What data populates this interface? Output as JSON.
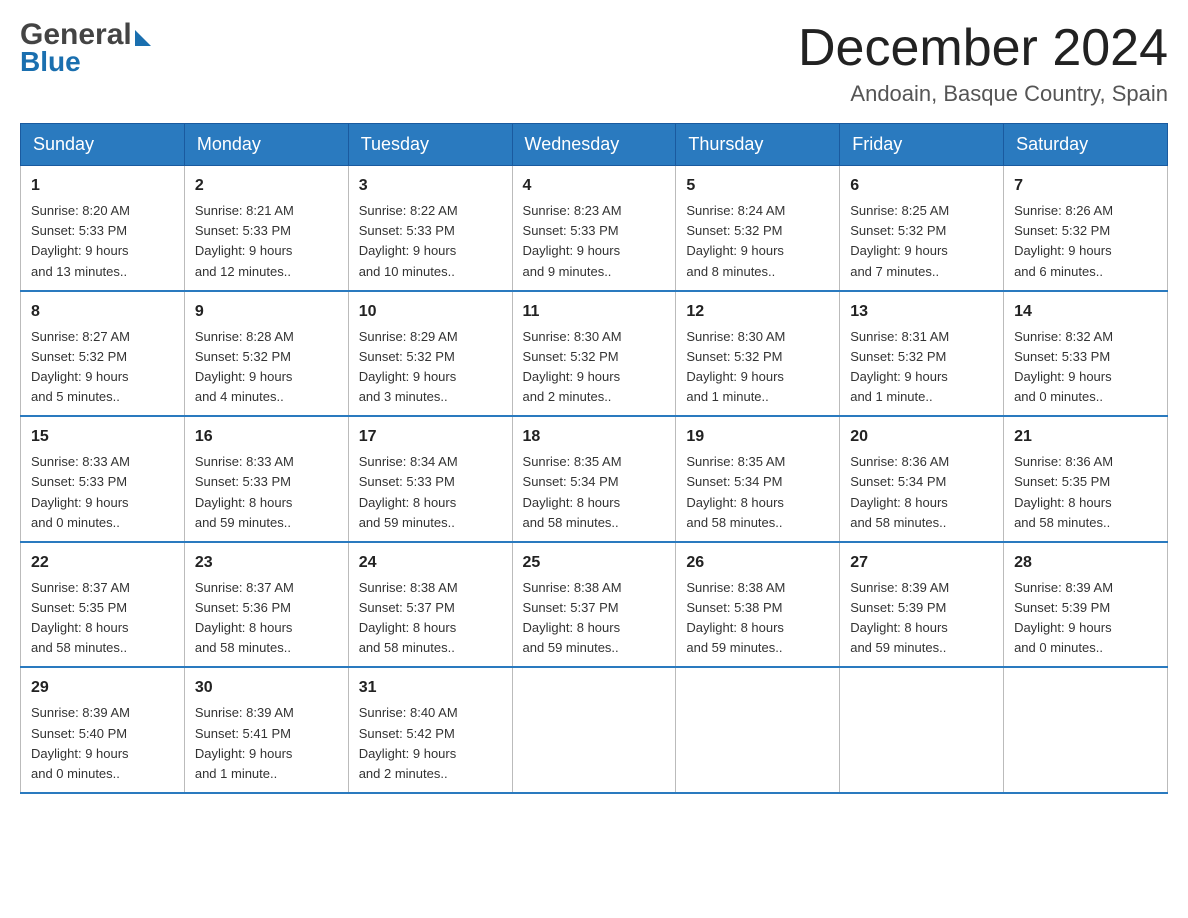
{
  "header": {
    "logo_general": "General",
    "logo_blue": "Blue",
    "month_title": "December 2024",
    "location": "Andoain, Basque Country, Spain"
  },
  "weekdays": [
    "Sunday",
    "Monday",
    "Tuesday",
    "Wednesday",
    "Thursday",
    "Friday",
    "Saturday"
  ],
  "weeks": [
    [
      {
        "day": "1",
        "sunrise": "8:20 AM",
        "sunset": "5:33 PM",
        "daylight": "9 hours and 13 minutes."
      },
      {
        "day": "2",
        "sunrise": "8:21 AM",
        "sunset": "5:33 PM",
        "daylight": "9 hours and 12 minutes."
      },
      {
        "day": "3",
        "sunrise": "8:22 AM",
        "sunset": "5:33 PM",
        "daylight": "9 hours and 10 minutes."
      },
      {
        "day": "4",
        "sunrise": "8:23 AM",
        "sunset": "5:33 PM",
        "daylight": "9 hours and 9 minutes."
      },
      {
        "day": "5",
        "sunrise": "8:24 AM",
        "sunset": "5:32 PM",
        "daylight": "9 hours and 8 minutes."
      },
      {
        "day": "6",
        "sunrise": "8:25 AM",
        "sunset": "5:32 PM",
        "daylight": "9 hours and 7 minutes."
      },
      {
        "day": "7",
        "sunrise": "8:26 AM",
        "sunset": "5:32 PM",
        "daylight": "9 hours and 6 minutes."
      }
    ],
    [
      {
        "day": "8",
        "sunrise": "8:27 AM",
        "sunset": "5:32 PM",
        "daylight": "9 hours and 5 minutes."
      },
      {
        "day": "9",
        "sunrise": "8:28 AM",
        "sunset": "5:32 PM",
        "daylight": "9 hours and 4 minutes."
      },
      {
        "day": "10",
        "sunrise": "8:29 AM",
        "sunset": "5:32 PM",
        "daylight": "9 hours and 3 minutes."
      },
      {
        "day": "11",
        "sunrise": "8:30 AM",
        "sunset": "5:32 PM",
        "daylight": "9 hours and 2 minutes."
      },
      {
        "day": "12",
        "sunrise": "8:30 AM",
        "sunset": "5:32 PM",
        "daylight": "9 hours and 1 minute."
      },
      {
        "day": "13",
        "sunrise": "8:31 AM",
        "sunset": "5:32 PM",
        "daylight": "9 hours and 1 minute."
      },
      {
        "day": "14",
        "sunrise": "8:32 AM",
        "sunset": "5:33 PM",
        "daylight": "9 hours and 0 minutes."
      }
    ],
    [
      {
        "day": "15",
        "sunrise": "8:33 AM",
        "sunset": "5:33 PM",
        "daylight": "9 hours and 0 minutes."
      },
      {
        "day": "16",
        "sunrise": "8:33 AM",
        "sunset": "5:33 PM",
        "daylight": "8 hours and 59 minutes."
      },
      {
        "day": "17",
        "sunrise": "8:34 AM",
        "sunset": "5:33 PM",
        "daylight": "8 hours and 59 minutes."
      },
      {
        "day": "18",
        "sunrise": "8:35 AM",
        "sunset": "5:34 PM",
        "daylight": "8 hours and 58 minutes."
      },
      {
        "day": "19",
        "sunrise": "8:35 AM",
        "sunset": "5:34 PM",
        "daylight": "8 hours and 58 minutes."
      },
      {
        "day": "20",
        "sunrise": "8:36 AM",
        "sunset": "5:34 PM",
        "daylight": "8 hours and 58 minutes."
      },
      {
        "day": "21",
        "sunrise": "8:36 AM",
        "sunset": "5:35 PM",
        "daylight": "8 hours and 58 minutes."
      }
    ],
    [
      {
        "day": "22",
        "sunrise": "8:37 AM",
        "sunset": "5:35 PM",
        "daylight": "8 hours and 58 minutes."
      },
      {
        "day": "23",
        "sunrise": "8:37 AM",
        "sunset": "5:36 PM",
        "daylight": "8 hours and 58 minutes."
      },
      {
        "day": "24",
        "sunrise": "8:38 AM",
        "sunset": "5:37 PM",
        "daylight": "8 hours and 58 minutes."
      },
      {
        "day": "25",
        "sunrise": "8:38 AM",
        "sunset": "5:37 PM",
        "daylight": "8 hours and 59 minutes."
      },
      {
        "day": "26",
        "sunrise": "8:38 AM",
        "sunset": "5:38 PM",
        "daylight": "8 hours and 59 minutes."
      },
      {
        "day": "27",
        "sunrise": "8:39 AM",
        "sunset": "5:39 PM",
        "daylight": "8 hours and 59 minutes."
      },
      {
        "day": "28",
        "sunrise": "8:39 AM",
        "sunset": "5:39 PM",
        "daylight": "9 hours and 0 minutes."
      }
    ],
    [
      {
        "day": "29",
        "sunrise": "8:39 AM",
        "sunset": "5:40 PM",
        "daylight": "9 hours and 0 minutes."
      },
      {
        "day": "30",
        "sunrise": "8:39 AM",
        "sunset": "5:41 PM",
        "daylight": "9 hours and 1 minute."
      },
      {
        "day": "31",
        "sunrise": "8:40 AM",
        "sunset": "5:42 PM",
        "daylight": "9 hours and 2 minutes."
      },
      null,
      null,
      null,
      null
    ]
  ],
  "labels": {
    "sunrise": "Sunrise:",
    "sunset": "Sunset:",
    "daylight": "Daylight:"
  }
}
